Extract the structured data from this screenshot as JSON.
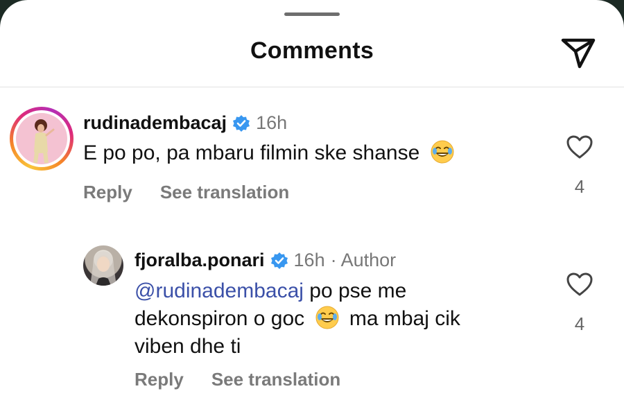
{
  "header": {
    "title": "Comments"
  },
  "comments": [
    {
      "username": "rudinadembacaj",
      "time": "16h",
      "text": "E po po, pa mbaru filmin ske shanse",
      "reply_label": "Reply",
      "translate_label": "See translation",
      "like_count": "4"
    },
    {
      "username": "fjoralba.ponari",
      "time": "16h",
      "author_label": "· Author",
      "mention": "@rudinadembacaj",
      "text_line1": " po pse me",
      "text_line2a": "dekonspiron o goc",
      "text_line2b": "ma mbaj cik",
      "text_line3": "viben dhe ti",
      "reply_label": "Reply",
      "translate_label": "See translation",
      "like_count": "4"
    }
  ],
  "colors": {
    "accent_verified": "#3897f0",
    "mention": "#3b50a8",
    "secondary_text": "#777777"
  },
  "icons": [
    "send-icon",
    "verified-badge-icon",
    "laughing-emoji-icon",
    "heart-icon"
  ]
}
